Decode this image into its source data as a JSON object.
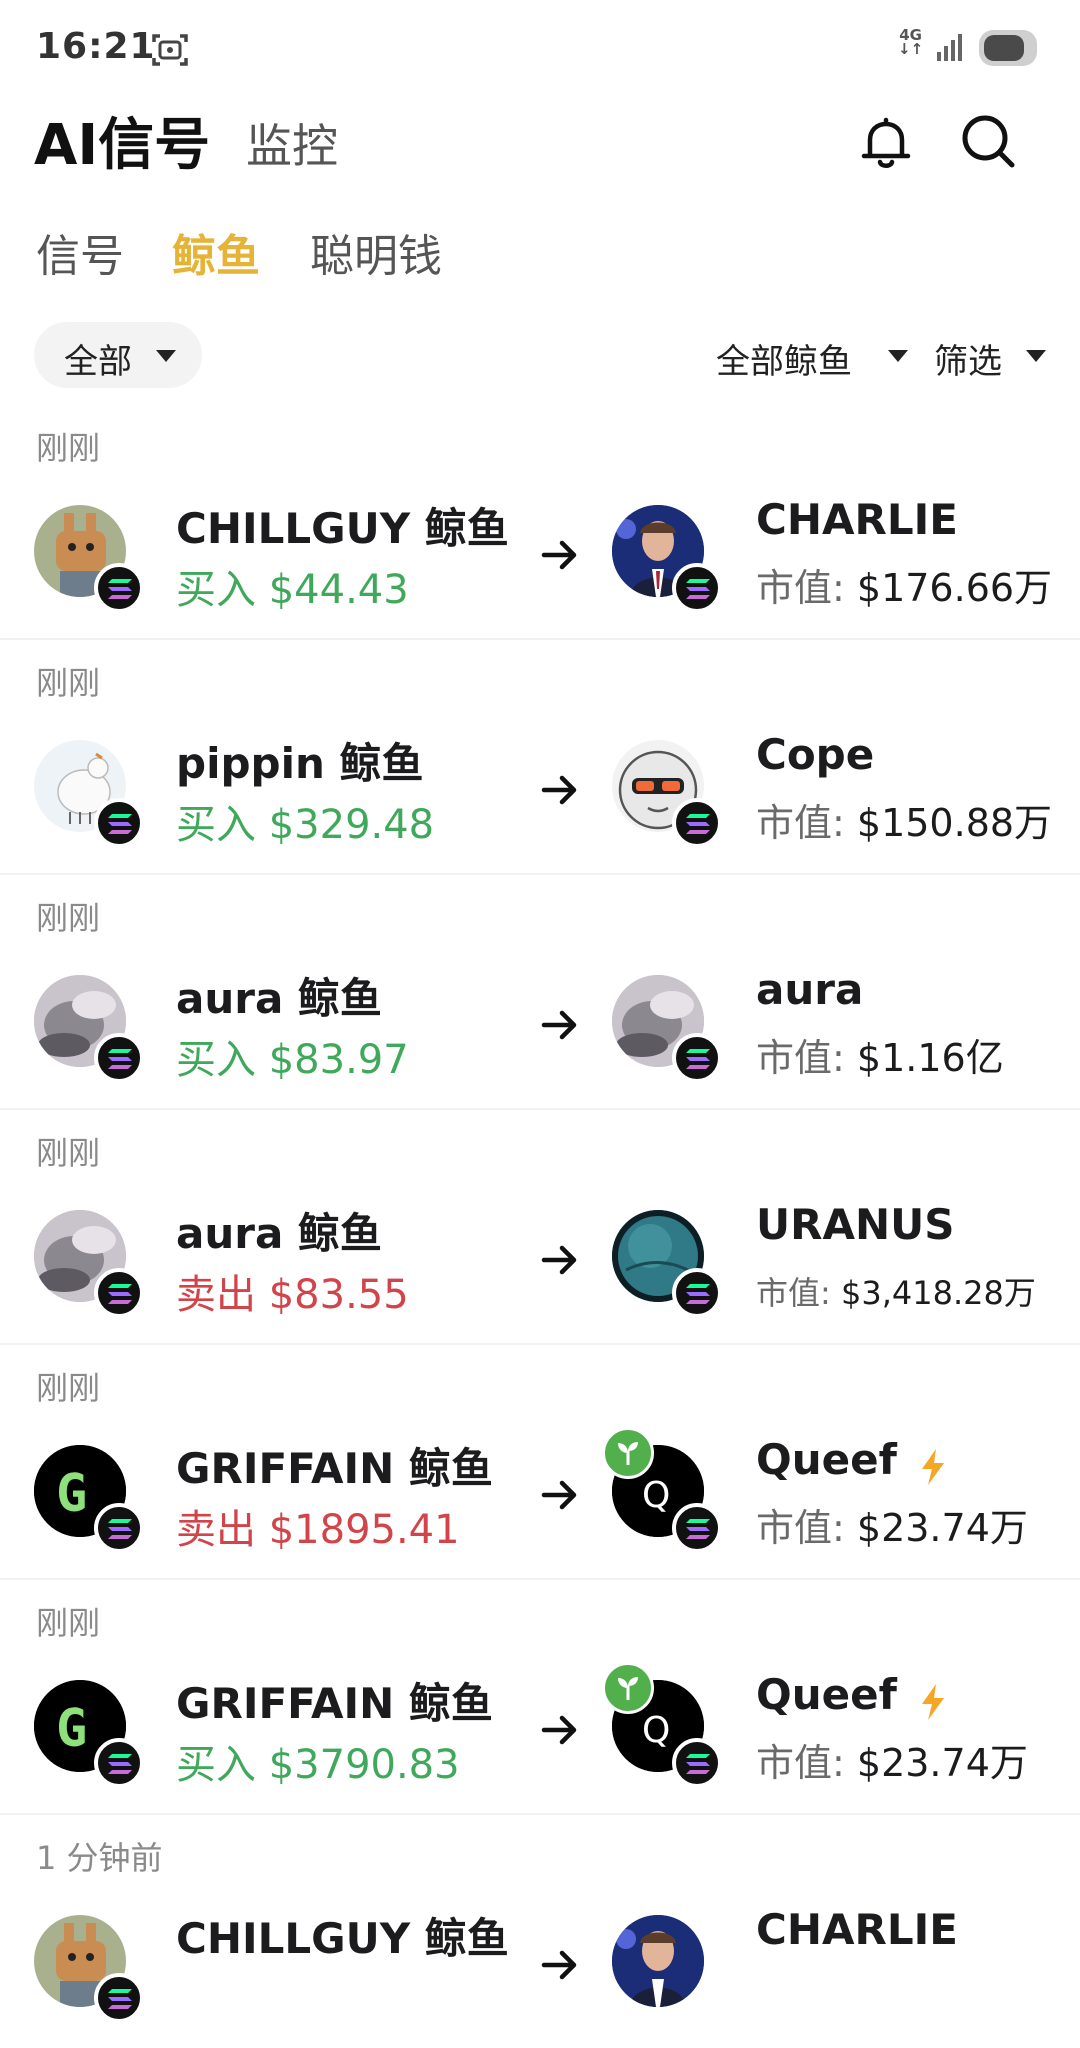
{
  "status_bar": {
    "time": "16:21",
    "network": "4G"
  },
  "header": {
    "title": "AI信号",
    "monitor_tab": "监控"
  },
  "sub_tabs": [
    {
      "label": "信号",
      "active": false
    },
    {
      "label": "鲸鱼",
      "active": true
    },
    {
      "label": "聪明钱",
      "active": false
    }
  ],
  "filters": {
    "all_label": "全部",
    "whales_dropdown": "全部鲸鱼",
    "filter_dropdown": "筛选"
  },
  "colors": {
    "accent": "#e5b437",
    "buy": "#3fa85a",
    "sell": "#d0444a",
    "chain_badge": "#111111",
    "new_badge": "#52b04c"
  },
  "feed": [
    {
      "time": "刚刚",
      "whale": "CHILLGUY 鲸鱼",
      "action": "买入",
      "amount": "$44.43",
      "side": "buy",
      "token": "CHARLIE",
      "mcap_label": "市值:",
      "mcap_value": "$176.66万",
      "whale_avatar": "chillguy",
      "token_avatar": "charlie"
    },
    {
      "time": "刚刚",
      "whale": "pippin 鲸鱼",
      "action": "买入",
      "amount": "$329.48",
      "side": "buy",
      "token": "Cope",
      "mcap_label": "市值:",
      "mcap_value": "$150.88万",
      "whale_avatar": "pippin",
      "token_avatar": "cope"
    },
    {
      "time": "刚刚",
      "whale": "aura 鲸鱼",
      "action": "买入",
      "amount": "$83.97",
      "side": "buy",
      "token": "aura",
      "mcap_label": "市值:",
      "mcap_value": "$1.16亿",
      "whale_avatar": "aura",
      "token_avatar": "aura"
    },
    {
      "time": "刚刚",
      "whale": "aura 鲸鱼",
      "action": "卖出",
      "amount": "$83.55",
      "side": "sell",
      "token": "URANUS",
      "mcap_label": "市值:",
      "mcap_value": "$3,418.28万",
      "whale_avatar": "aura",
      "token_avatar": "uranus"
    },
    {
      "time": "刚刚",
      "whale": "GRIFFAIN 鲸鱼",
      "action": "卖出",
      "amount": "$1895.41",
      "side": "sell",
      "token": "Queef",
      "mcap_label": "市值:",
      "mcap_value": "$23.74万",
      "whale_avatar": "griffain",
      "token_avatar": "queef",
      "token_avatar_letter": "Q",
      "whale_avatar_letter": "G"
    },
    {
      "time": "刚刚",
      "whale": "GRIFFAIN 鲸鱼",
      "action": "买入",
      "amount": "$3790.83",
      "side": "buy",
      "token": "Queef",
      "mcap_label": "市值:",
      "mcap_value": "$23.74万",
      "whale_avatar": "griffain",
      "token_avatar": "queef",
      "token_avatar_letter": "Q",
      "whale_avatar_letter": "G"
    },
    {
      "time": "1 分钟前",
      "whale": "CHILLGUY 鲸鱼",
      "token": "CHARLIE",
      "whale_avatar": "chillguy",
      "token_avatar": "charlie"
    }
  ]
}
